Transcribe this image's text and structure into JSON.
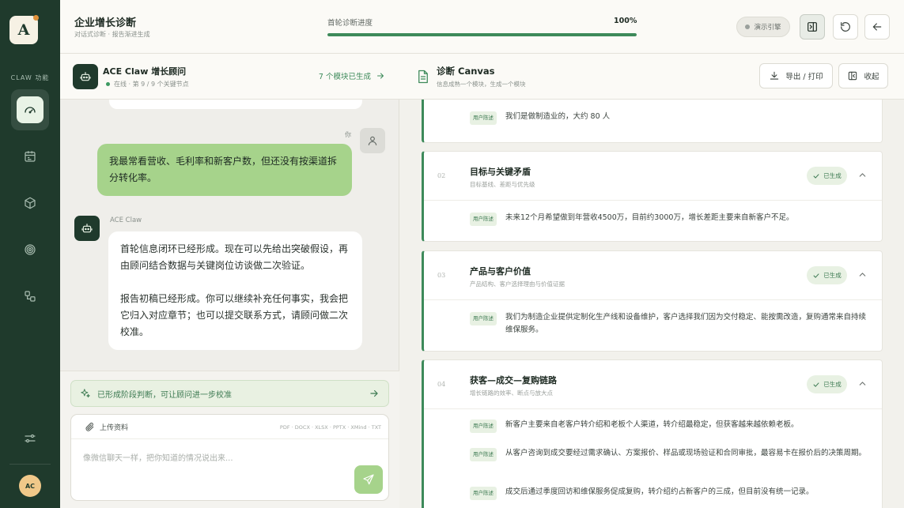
{
  "sidebar": {
    "logo_letter": "A",
    "section_label": "CLAW 功能",
    "items": [
      {
        "icon": "gauge-icon"
      },
      {
        "icon": "calendar-icon"
      },
      {
        "icon": "box-icon"
      },
      {
        "icon": "target-icon"
      },
      {
        "icon": "nodes-icon"
      }
    ],
    "settings_icon": "sliders-icon",
    "avatar_initials": "AC"
  },
  "header": {
    "title": "企业增长诊断",
    "subtitle": "对话式诊断 · 报告渐进生成",
    "progress_label": "首轮诊断进度",
    "progress_text": "100%",
    "progress_value": 1.0,
    "demo_label": "演示引擎"
  },
  "chat": {
    "title": "ACE Claw 增长顾问",
    "status": "在线 · 第 9 / 9 个关键节点",
    "modules_link": "7 个模块已生成",
    "you_label": "你",
    "user_message": "我最常看营收、毛利率和新客户数，但还没有按渠道拆分转化率。",
    "bot_name": "ACE Claw",
    "bot_paragraphs": [
      "首轮信息闭环已经形成。现在可以先给出突破假设，再由顾问结合数据与关键岗位访谈做二次验证。",
      "报告初稿已经形成。你可以继续补充任何事实，我会把它归入对应章节；也可以提交联系方式，请顾问做二次校准。"
    ],
    "stage_banner": "已形成阶段判断，可让顾问进一步校准",
    "upload_label": "上传资料",
    "file_types": "PDF · DOCX · XLSX · PPTX · XMind · TXT",
    "input_placeholder": "像微信聊天一样，把你知道的情况说出来..."
  },
  "canvas": {
    "title": "诊断 Canvas",
    "subtitle": "信息成熟一个模块，生成一个模块",
    "export_label": "导出 / 打印",
    "collapse_label": "收起",
    "tag_label": "用户陈述",
    "done_label": "已生成",
    "cards": [
      {
        "rows": [
          "我们是做制造业的，大约 80 人"
        ]
      },
      {
        "num": "02",
        "title": "目标与关键矛盾",
        "subtitle": "目标基线、差距与优先级",
        "rows": [
          "未来12个月希望做到年营收4500万，目前约3000万，增长差距主要来自新客户不足。"
        ]
      },
      {
        "num": "03",
        "title": "产品与客户价值",
        "subtitle": "产品结构、客户选择理由与价值证据",
        "rows": [
          "我们为制造企业提供定制化生产线和设备维护，客户选择我们因为交付稳定、能按需改造，复购通常来自持续维保服务。"
        ]
      },
      {
        "num": "04",
        "title": "获客—成交—复购链路",
        "subtitle": "增长链路的效率、断点与放大点",
        "rows": [
          "新客户主要来自老客户转介绍和老板个人渠道，转介绍最稳定，但获客越来越依赖老板。",
          "从客户咨询到成交要经过需求确认、方案报价、样品或现场验证和合同审批，最容易卡在报价后的决策周期。",
          "成交后通过季度回访和维保服务促成复购，转介绍约占新客户的三成，但目前没有统一记录。"
        ]
      }
    ]
  }
}
